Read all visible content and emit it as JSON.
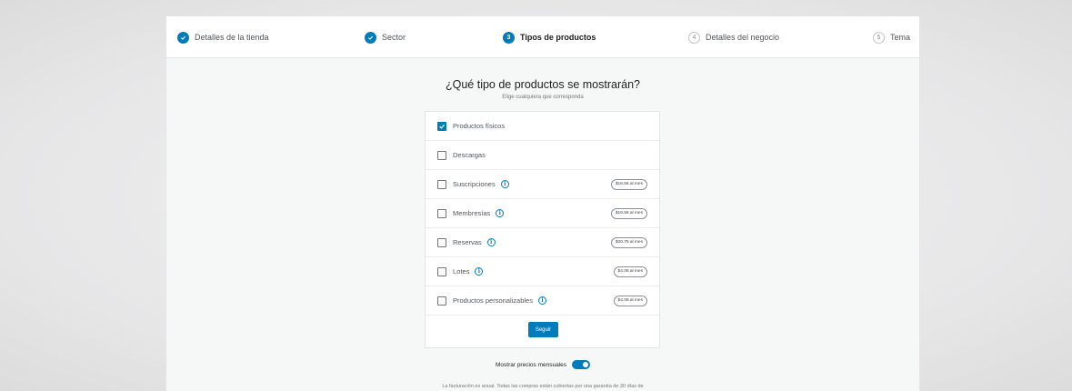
{
  "stepper": {
    "steps": [
      {
        "number": "",
        "label": "Detalles de la tienda",
        "status": "done"
      },
      {
        "number": "",
        "label": "Sector",
        "status": "done"
      },
      {
        "number": "3",
        "label": "Tipos de productos",
        "status": "active"
      },
      {
        "number": "4",
        "label": "Detalles del negocio",
        "status": "pending"
      },
      {
        "number": "5",
        "label": "Tema",
        "status": "pending"
      }
    ]
  },
  "main": {
    "title": "¿Qué tipo de productos se mostrarán?",
    "subtitle": "Elige cualquiera que corresponda",
    "options": [
      {
        "label": "Productos físicos",
        "checked": true,
        "price": ""
      },
      {
        "label": "Descargas",
        "checked": false,
        "price": ""
      },
      {
        "label": "Suscripciones",
        "checked": false,
        "price": "$16.58 al mes"
      },
      {
        "label": "Membresías",
        "checked": false,
        "price": "$16.58 al mes"
      },
      {
        "label": "Reservas",
        "checked": false,
        "price": "$20.75 al mes"
      },
      {
        "label": "Lotes",
        "checked": false,
        "price": "$4.08 al mes"
      },
      {
        "label": "Productos personalizables",
        "checked": false,
        "price": "$4.08 al mes"
      }
    ],
    "continue_label": "Seguir",
    "toggle_label": "Mostrar precios mensuales",
    "toggle_on": true,
    "footer": "La facturación es anual. Todas las compras están cubiertas por una garantía de 30 días de"
  },
  "colors": {
    "accent": "#007cba"
  }
}
